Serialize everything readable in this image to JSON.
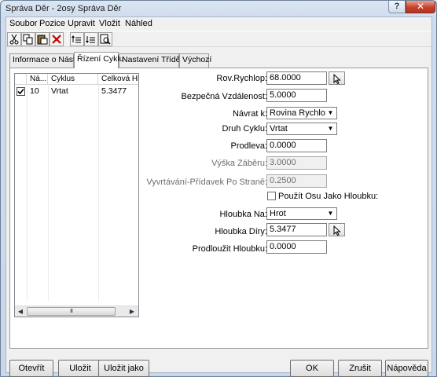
{
  "window": {
    "title": "Správa Děr - 2osy Správa Děr",
    "help_label": "?",
    "close_label": "✕"
  },
  "menu": [
    "Soubor",
    "Pozice",
    "Upravit",
    "Vložit",
    "Náhled"
  ],
  "toolbar": [
    "scissors-icon",
    "copy-icon",
    "paste-icon",
    "delete-icon",
    "move-up-icon",
    "move-down-icon",
    "preview-icon"
  ],
  "tabs": [
    "Informace o Nástroji",
    "Řízení Cyklu",
    "Nastavení Třídění",
    "Výchozí"
  ],
  "list": {
    "columns": [
      "Ná...",
      "Cyklus",
      "Celková Hlou"
    ],
    "rows": [
      {
        "checked": true,
        "tool": "10",
        "cycle": "Vrtat",
        "depth": "5.3477"
      }
    ],
    "scroll_grip": "III"
  },
  "form": {
    "rov_rychlop": {
      "label": "Rov.Rychlop:",
      "value": "68.0000"
    },
    "bezpecna": {
      "label": "Bezpečná Vzdálenost:",
      "value": "5.0000"
    },
    "navrat": {
      "label": "Návrat k:",
      "value": "Rovina Rychlop."
    },
    "druh_cyklu": {
      "label": "Druh Cyklu:",
      "value": "Vrtat"
    },
    "prodleva": {
      "label": "Prodleva:",
      "value": "0.0000"
    },
    "vyska_zaberu": {
      "label": "Výška Záběru:",
      "value": "3.0000"
    },
    "vyvrtavani": {
      "label": "Vyvrtávání-Přídavek Po Straně:",
      "value": "0.2500"
    },
    "pouzit_osu": {
      "label": "Použít Osu Jako Hloubku:",
      "checked": false
    },
    "hloubka_na": {
      "label": "Hloubka Na:",
      "value": "Hrot"
    },
    "hloubka_diry": {
      "label": "Hloubka Díry:",
      "value": "5.3477"
    },
    "prodlouzit": {
      "label": "Prodloužit Hloubku:",
      "value": "0.0000"
    }
  },
  "buttons": {
    "open": "Otevřít",
    "save": "Uložit",
    "save_as": "Uložit jako",
    "ok": "OK",
    "cancel": "Zrušit",
    "help": "Nápověda"
  }
}
